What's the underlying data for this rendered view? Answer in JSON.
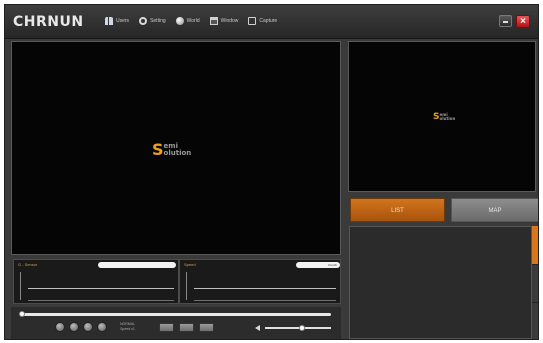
{
  "app": {
    "logo": "CHRNUN"
  },
  "nav": [
    {
      "label": "Users",
      "icon": "users-icon"
    },
    {
      "label": "Setting",
      "icon": "gear-icon"
    },
    {
      "label": "World",
      "icon": "globe-icon"
    },
    {
      "label": "Window",
      "icon": "window-icon"
    },
    {
      "label": "Capture",
      "icon": "page-icon"
    }
  ],
  "brand": {
    "letter": "S",
    "line1": "emi",
    "line2": "olution"
  },
  "buttons": {
    "list": "LIST",
    "map": "MAP"
  },
  "graphs": {
    "left_label": "G - Sensor",
    "right_label": "Speed",
    "right_field": "0 km/h"
  },
  "controls": {
    "speed_line1": "NORMAL",
    "speed_line2": "Speed x1"
  },
  "colors": {
    "accent": "#d9771f",
    "close": "#c81e1e",
    "brand": "#f0a01c"
  }
}
